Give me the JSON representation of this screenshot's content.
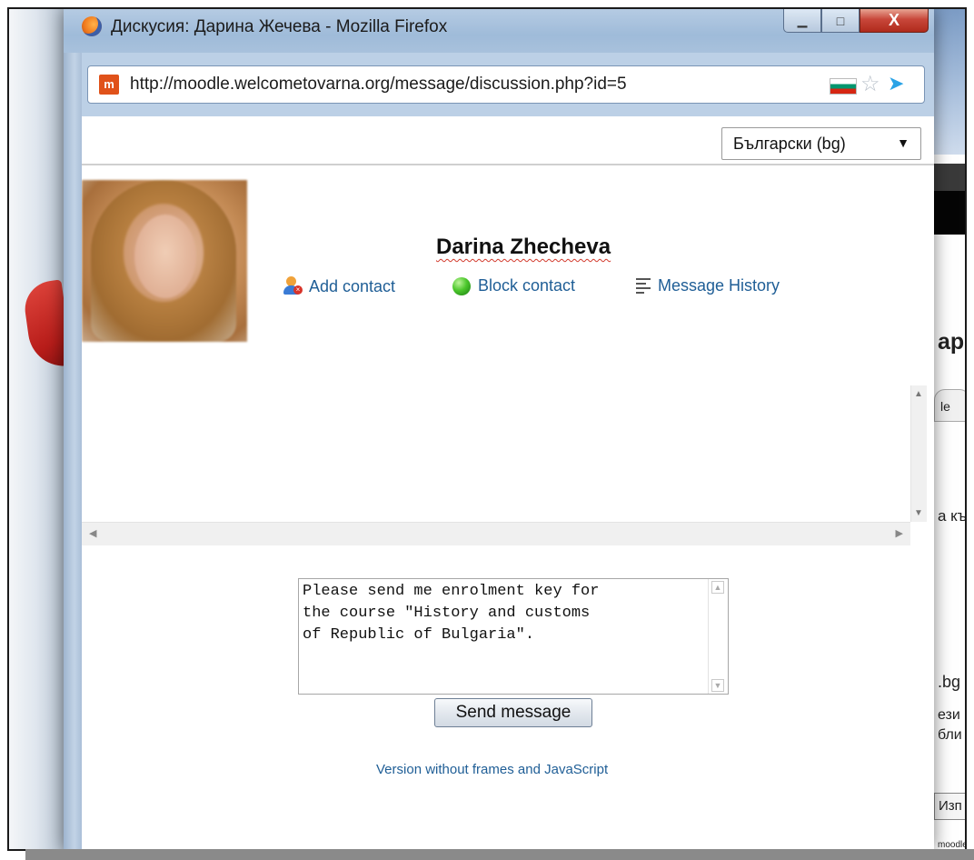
{
  "window": {
    "title": "Дискусия: Дарина Жечева - Mozilla Firefox",
    "controls": {
      "minimize": "▁",
      "maximize": "□",
      "close": "X"
    }
  },
  "address_bar": {
    "url": "http://moodle.welcometovarna.org/message/discussion.php?id=5",
    "site_icon_text": "m"
  },
  "language_select": {
    "value": "Български (bg)",
    "caret": "▼"
  },
  "profile": {
    "name": "Darina Zhecheva"
  },
  "actions": {
    "add_contact": "Add contact",
    "block_contact": "Block contact",
    "message_history": "Message History"
  },
  "compose": {
    "message": "Please send me enrolment key for\nthe course \"History and customs\nof Republic of Bulgaria\".",
    "send_label": "Send message"
  },
  "noframes_link": "Version without frames and JavaScript",
  "background_fragments": {
    "ap": "ap",
    "le": "le",
    "a_k": "a къ",
    "bg": ".bg",
    "ezik": "ези",
    "bli": "бли",
    "izp": "Изп",
    "bottom": "moodle"
  },
  "colors": {
    "link": "#1f5e96",
    "titlebar": "#a8c1dc",
    "close_button": "#c8473a"
  },
  "icons": {
    "browser": "firefox-icon",
    "site": "moodle-icon",
    "flag": "bulgaria-flag-icon",
    "bookmark": "star-icon",
    "share": "twitter-bird-icon",
    "add_contact": "add-user-icon",
    "block_contact": "green-circle-icon",
    "message_history": "history-list-icon"
  }
}
